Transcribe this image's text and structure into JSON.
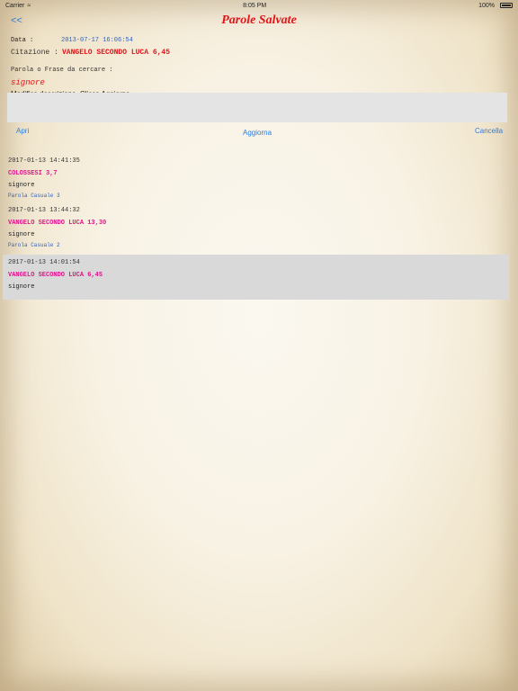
{
  "status_bar": {
    "carrier": "Carrier",
    "time": "8:05 PM",
    "battery": "100%"
  },
  "nav": {
    "back_label": "<<",
    "title": "Parole Salvate"
  },
  "form": {
    "data_label": "Data :",
    "data_value": "2013-07-17 16:06:54",
    "citazione_label": "Citazione :",
    "citazione_value": "VANGELO SECONDO LUCA 6,45",
    "parola_label": "Parola o Frase da cercare :",
    "parola_value": "signore",
    "hint": "Modifica descrizione. Clicca Aggiorna.",
    "input_value": ""
  },
  "actions": {
    "apri": "Apri",
    "aggiorna": "Aggiorna",
    "cancella": "Cancella"
  },
  "list": [
    {
      "date": "2017-01-13 14:41:35",
      "citazione": "COLOSSESI 3,7",
      "parola": "signore",
      "descrizione": "Parola Casuale 3",
      "selected": false
    },
    {
      "date": "2017-01-13 13:44:32",
      "citazione": "VANGELO SECONDO LUCA 13,30",
      "parola": "signore",
      "descrizione": "Parola Casuale 2",
      "selected": false
    },
    {
      "date": "2017-01-13 14:01:54",
      "citazione": "VANGELO SECONDO LUCA 6,45",
      "parola": "signore",
      "descrizione": "",
      "selected": true
    }
  ],
  "colors": {
    "accent_blue": "#2a7de1",
    "title_red": "#e2141a",
    "citation_magenta": "#e0168a",
    "selected_row": "#d9d9d9",
    "input_bg": "#e4e4e4"
  }
}
